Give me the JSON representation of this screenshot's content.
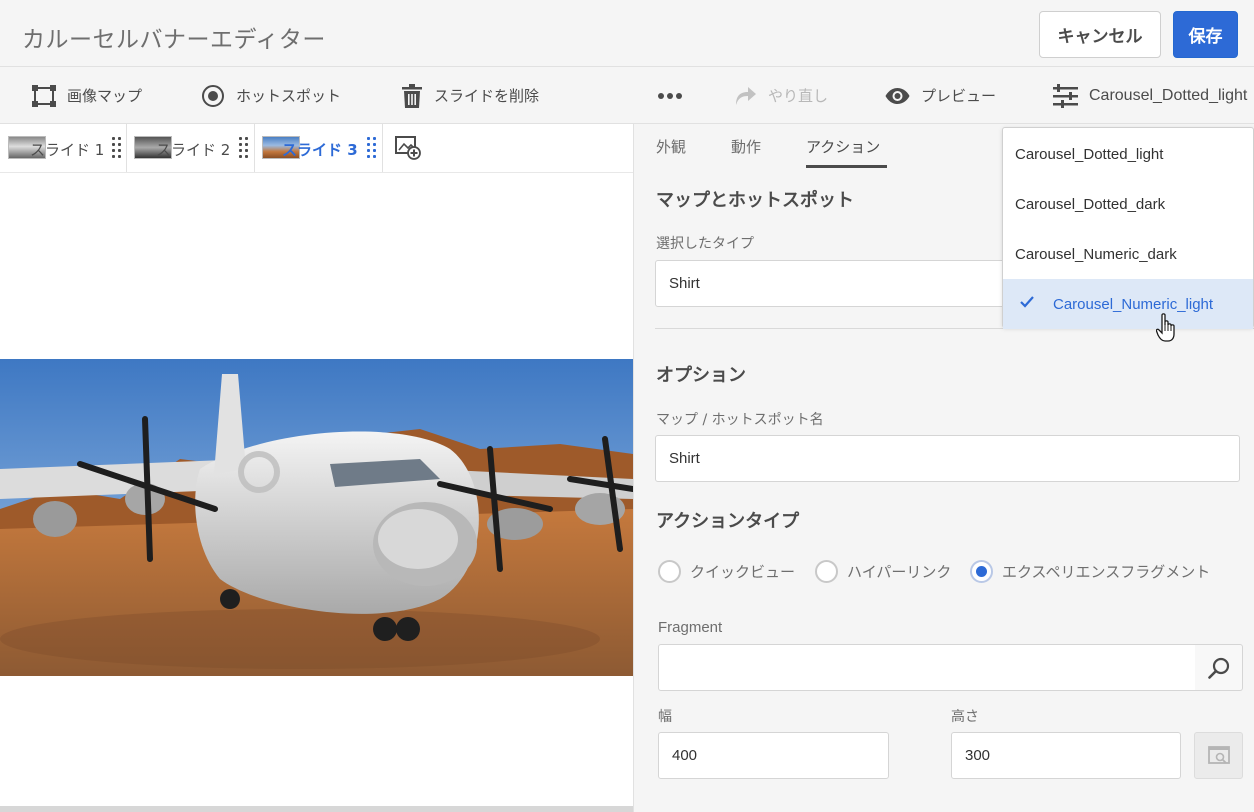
{
  "header": {
    "title": "カルーセルバナーエディター",
    "cancel_label": "キャンセル",
    "save_label": "保存"
  },
  "toolbar": {
    "image_map": "画像マップ",
    "hotspot": "ホットスポット",
    "delete_slide": "スライドを削除",
    "redo": "やり直し",
    "preview": "プレビュー",
    "viewer_preset": "Carousel_Dotted_light"
  },
  "slides": [
    {
      "label": "スライド 1",
      "active": false
    },
    {
      "label": "スライド 2",
      "active": false
    },
    {
      "label": "スライド 3",
      "active": true
    }
  ],
  "panel": {
    "tabs": [
      "外観",
      "動作",
      "アクション"
    ],
    "active_tab": "アクション",
    "map_section_title": "マップとホットスポット",
    "selected_type_label": "選択したタイプ",
    "selected_type_value": "Shirt",
    "options_title": "オプション",
    "map_name_label": "マップ / ホットスポット名",
    "map_name_value": "Shirt",
    "action_type_title": "アクションタイプ",
    "action_types": [
      "クイックビュー",
      "ハイパーリンク",
      "エクスペリエンスフラグメント"
    ],
    "selected_action": "エクスペリエンスフラグメント",
    "fragment_label": "Fragment",
    "fragment_value": "",
    "width_label": "幅",
    "width_value": "400",
    "height_label": "高さ",
    "height_value": "300"
  },
  "preset_dropdown": {
    "options": [
      "Carousel_Dotted_light",
      "Carousel_Dotted_dark",
      "Carousel_Numeric_dark",
      "Carousel_Numeric_light"
    ],
    "selected": "Carousel_Numeric_light"
  },
  "colors": {
    "accent": "#2d6ad6",
    "header_bg": "#f5f5f5",
    "selected_bg": "#dde8f7"
  }
}
